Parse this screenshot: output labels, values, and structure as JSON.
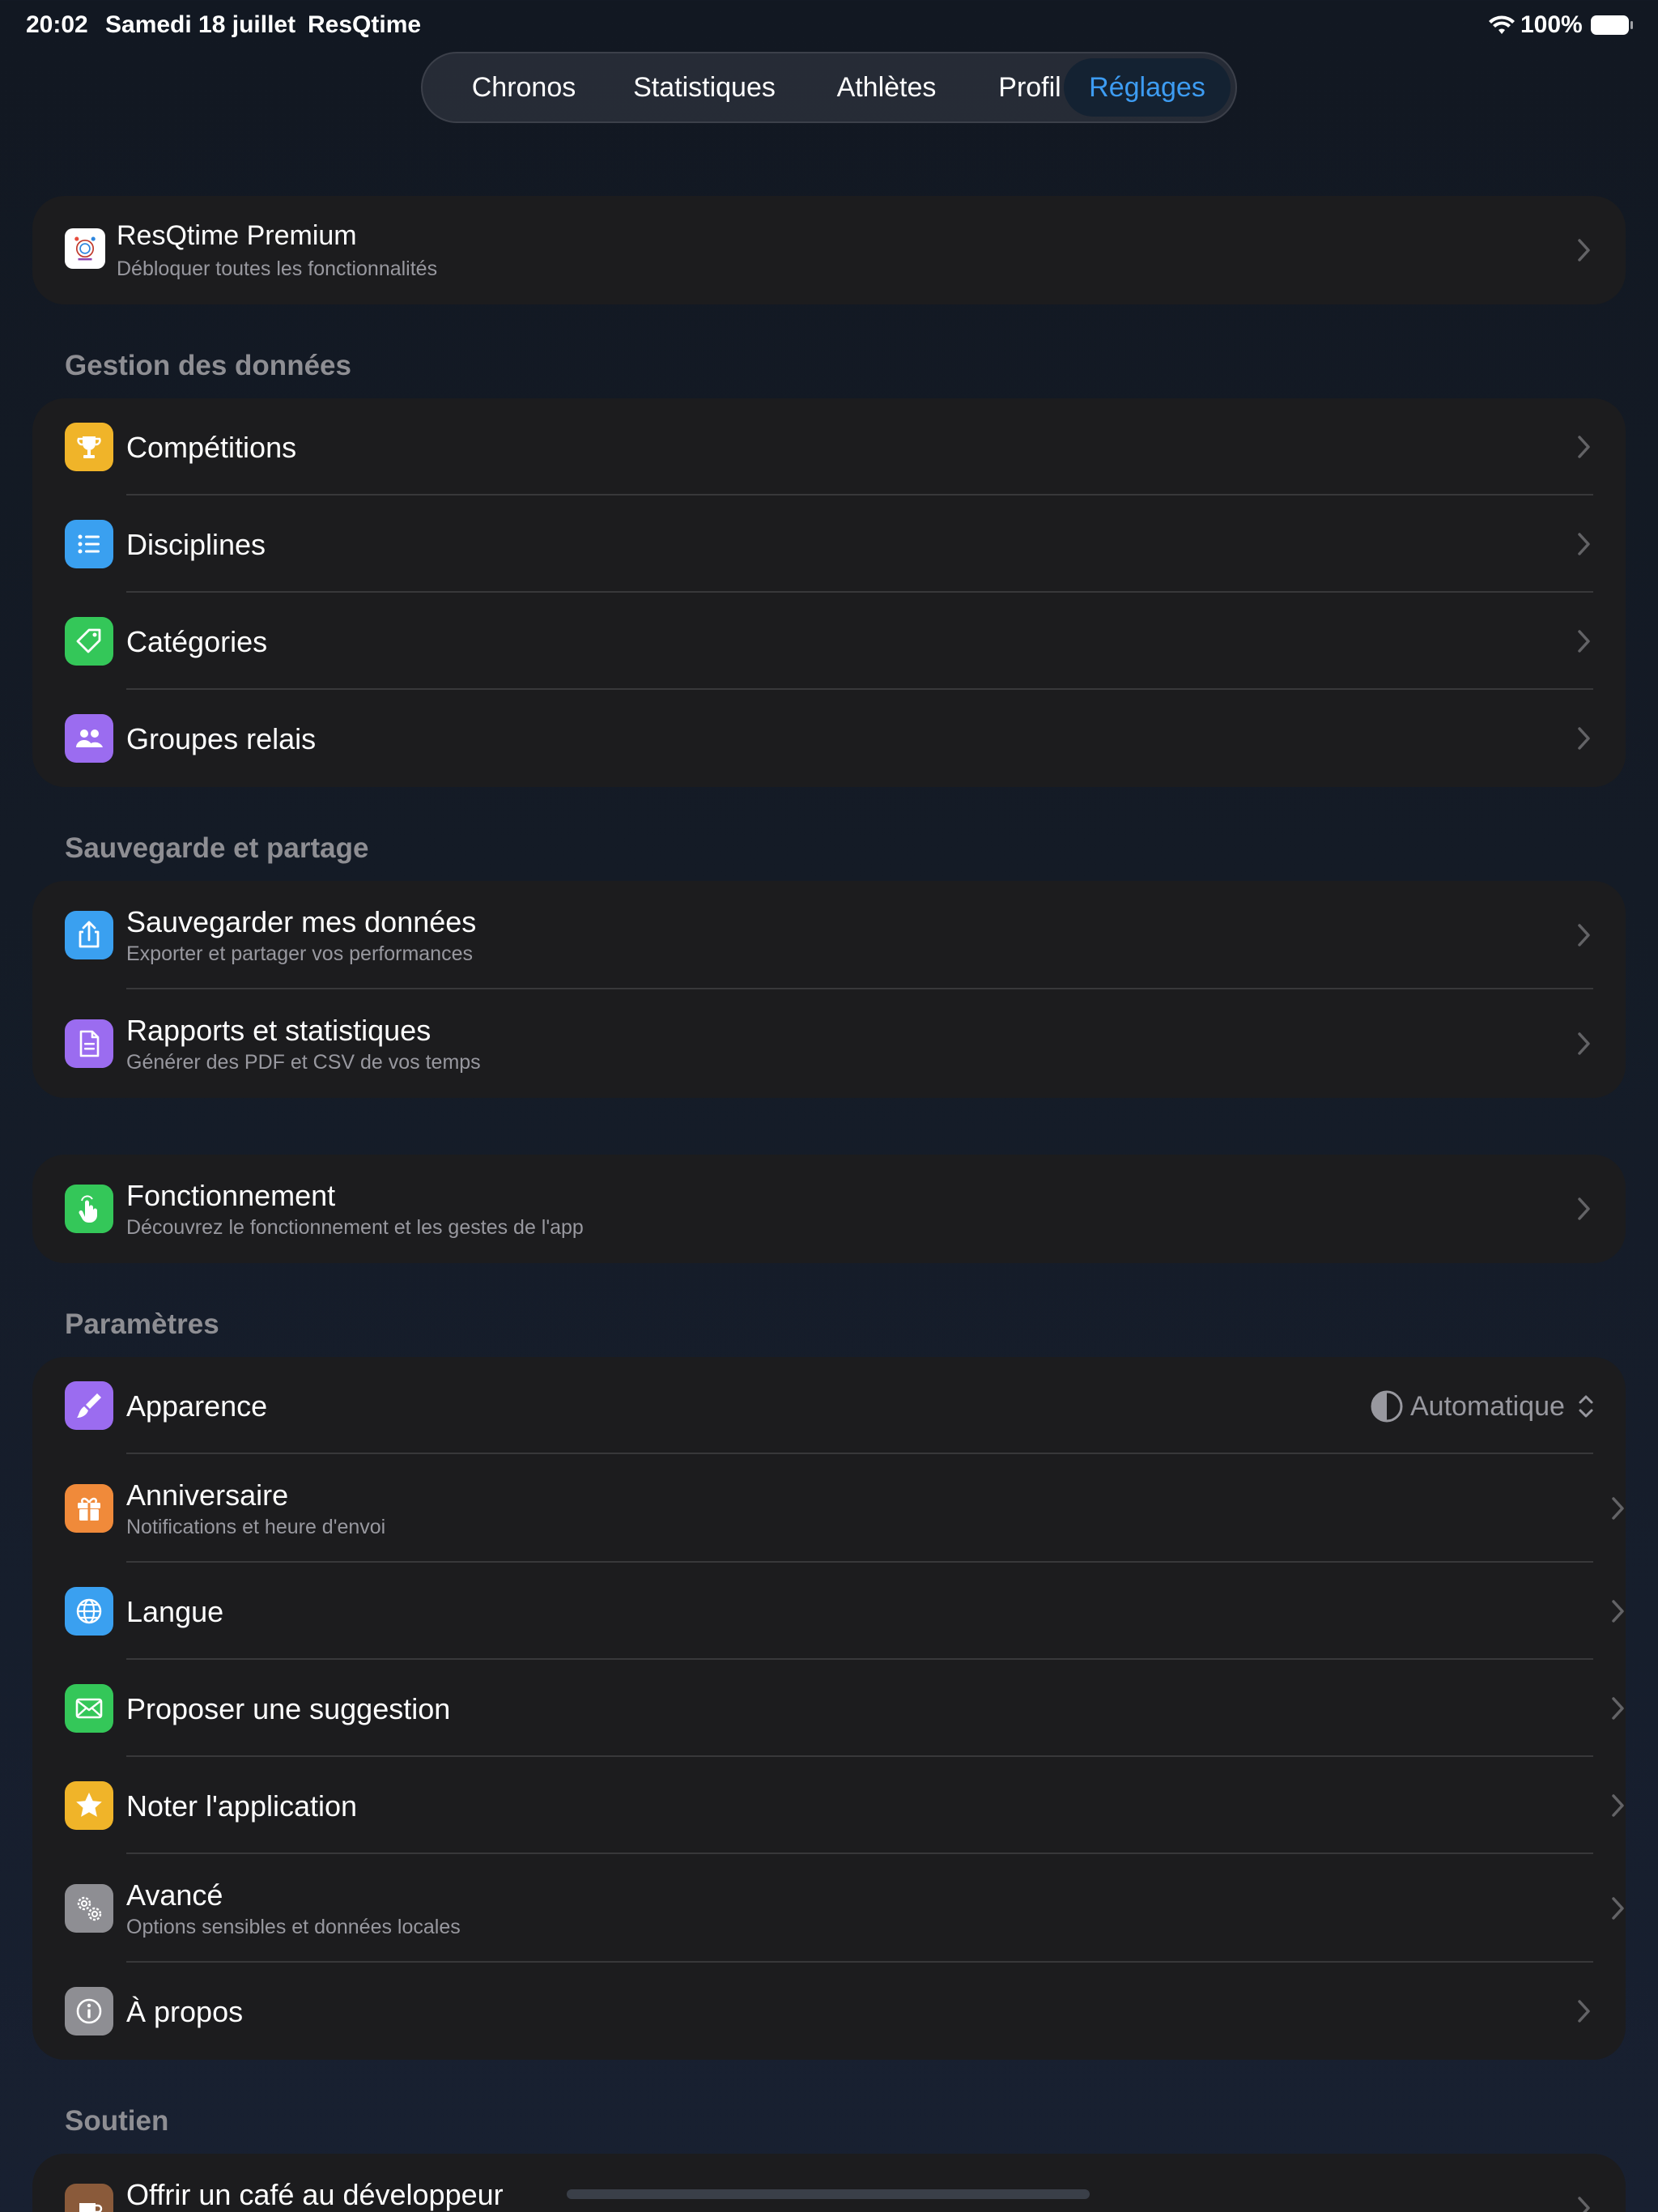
{
  "status_bar": {
    "time": "20:02",
    "date": "Samedi 18 juillet",
    "app": "ResQtime",
    "battery": "100%"
  },
  "tabs": [
    {
      "label": "Chronos",
      "active": false
    },
    {
      "label": "Statistiques",
      "active": false
    },
    {
      "label": "Athlètes",
      "active": false
    },
    {
      "label": "Profil",
      "active": false
    },
    {
      "label": "Réglages",
      "active": true
    }
  ],
  "premium": {
    "title": "ResQtime Premium",
    "subtitle": "Débloquer toutes les fonctionnalités"
  },
  "sections": {
    "data_management": {
      "header": "Gestion des données",
      "items": [
        {
          "title": "Compétitions",
          "icon": "trophy-icon"
        },
        {
          "title": "Disciplines",
          "icon": "list-icon"
        },
        {
          "title": "Catégories",
          "icon": "tag-icon"
        },
        {
          "title": "Groupes relais",
          "icon": "people-icon"
        }
      ]
    },
    "backup": {
      "header": "Sauvegarde et partage",
      "items": [
        {
          "title": "Sauvegarder mes données",
          "subtitle": "Exporter et partager vos performances",
          "icon": "share-icon"
        },
        {
          "title": "Rapports et statistiques",
          "subtitle": "Générer des PDF et CSV de vos temps",
          "icon": "document-icon"
        }
      ]
    },
    "how_it_works": {
      "title": "Fonctionnement",
      "subtitle": "Découvrez le fonctionnement et les gestes de l'app",
      "icon": "hand-tap-icon"
    },
    "settings": {
      "header": "Paramètres",
      "appearance": {
        "title": "Apparence",
        "value": "Automatique",
        "icon": "paintbrush-icon"
      },
      "birthday": {
        "title": "Anniversaire",
        "subtitle": "Notifications et heure d'envoi",
        "icon": "gift-icon"
      },
      "language": {
        "title": "Langue",
        "icon": "globe-icon"
      },
      "suggestion": {
        "title": "Proposer une suggestion",
        "icon": "envelope-icon"
      },
      "rate": {
        "title": "Noter l'application",
        "icon": "star-icon"
      },
      "advanced": {
        "title": "Avancé",
        "subtitle": "Options sensibles et données locales",
        "icon": "gears-icon"
      },
      "about": {
        "title": "À propos",
        "icon": "info-icon"
      }
    },
    "support": {
      "header": "Soutien",
      "coffee": {
        "title": "Offrir un café au développeur",
        "icon": "coffee-icon"
      }
    }
  },
  "colors": {
    "accent": "#3d9cf2",
    "trophy": "#f0b429",
    "list": "#3aa0f0",
    "tag": "#34c759",
    "people": "#9b6cf0",
    "share": "#3aa0f0",
    "document": "#9b6cf0",
    "hand": "#34c759",
    "paintbrush": "#9b6cf0",
    "gift": "#f08a3a",
    "globe": "#3aa0f0",
    "envelope": "#34c759",
    "star": "#f0b429",
    "gears": "#8e8e93",
    "info": "#8e8e93",
    "coffee": "#8a5a3a"
  }
}
